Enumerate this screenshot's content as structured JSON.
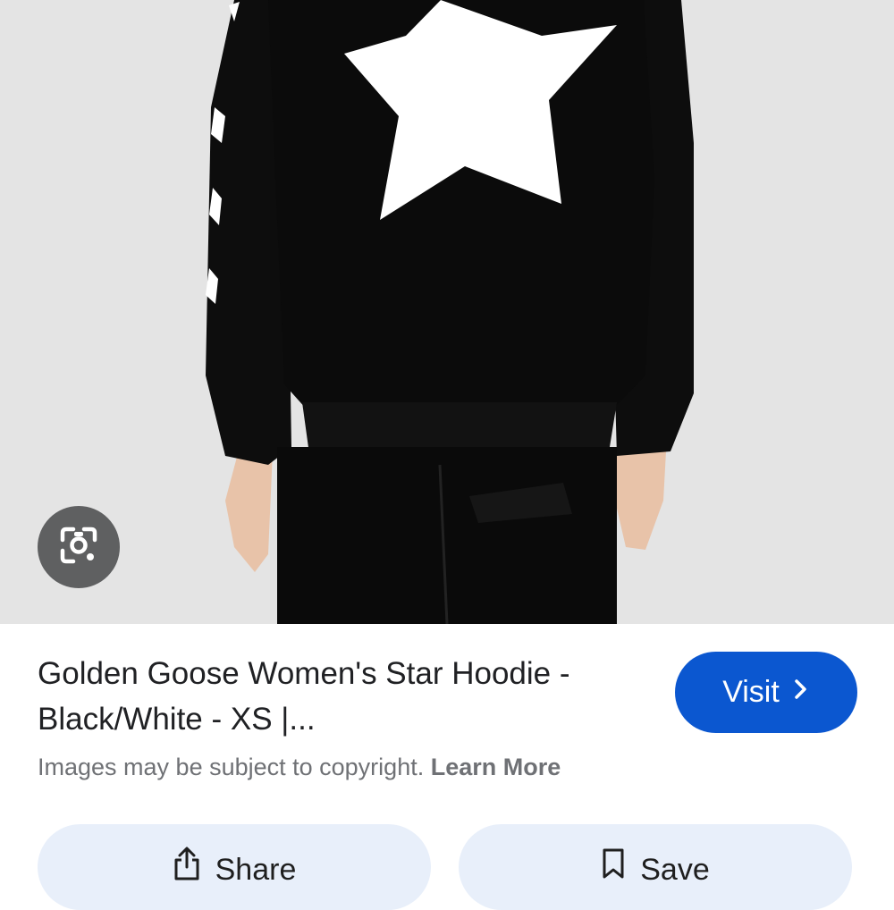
{
  "result": {
    "title": "Golden Goose Women's Star Hoodie - Black/White - XS |...",
    "copyright_text": "Images may be subject to copyright.",
    "learn_more_label": "Learn More"
  },
  "buttons": {
    "visit_label": "Visit",
    "share_label": "Share",
    "save_label": "Save"
  },
  "icons": {
    "lens": "google-lens-icon",
    "visit_arrow": "chevron-right-icon",
    "share": "share-icon",
    "save": "bookmark-icon"
  },
  "colors": {
    "accent": "#0b57d0",
    "action_button_bg": "#e8effa",
    "photo_background": "#e4e4e4",
    "lens_button_bg": "#5f6061"
  }
}
